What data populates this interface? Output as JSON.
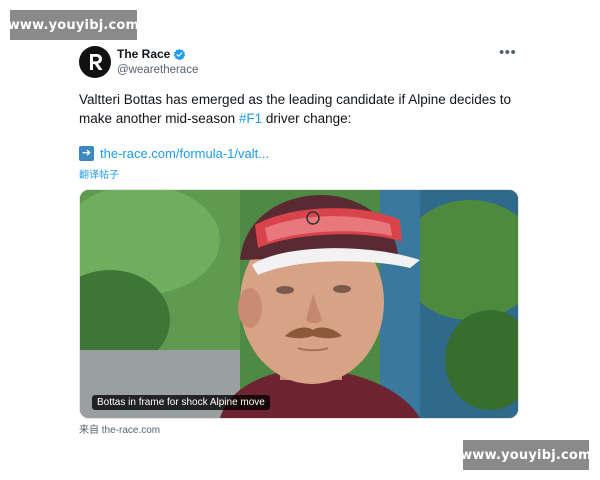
{
  "watermarks": {
    "top": "www.youyibj.com",
    "bottom": "www.youyibj.com"
  },
  "tweet": {
    "author_name": "The Race",
    "author_handle": "@wearetherace",
    "avatar_letter": "R",
    "text_before": "Valtteri Bottas has emerged as the leading candidate if Alpine decides to make another mid-season ",
    "hashtag": "#F1",
    "text_after": " driver change:",
    "link_text": "the-race.com/formula-1/valt...",
    "translate_label": "翻译帖子",
    "image_caption": "Bottas in frame for shock Alpine move",
    "source_label": "来自 the-race.com",
    "more_icon": "more-horizontal-icon"
  },
  "colors": {
    "link": "#1d9bf0",
    "verified": "#1d9bf0",
    "arrow_box": "#3b88c3"
  }
}
